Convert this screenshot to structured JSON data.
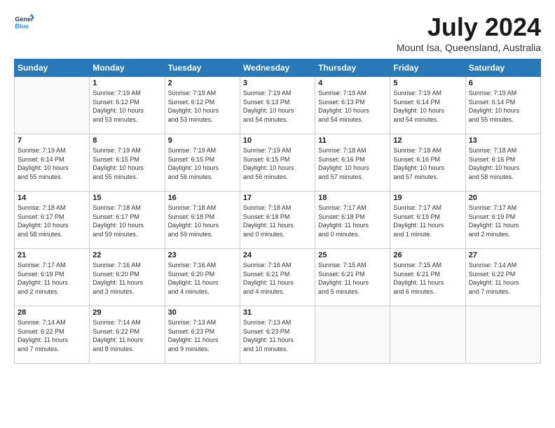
{
  "logo": {
    "line1": "General",
    "line2": "Blue"
  },
  "title": "July 2024",
  "location": "Mount Isa, Queensland, Australia",
  "headers": [
    "Sunday",
    "Monday",
    "Tuesday",
    "Wednesday",
    "Thursday",
    "Friday",
    "Saturday"
  ],
  "weeks": [
    [
      {
        "num": "",
        "info": ""
      },
      {
        "num": "1",
        "info": "Sunrise: 7:19 AM\nSunset: 6:12 PM\nDaylight: 10 hours\nand 53 minutes."
      },
      {
        "num": "2",
        "info": "Sunrise: 7:19 AM\nSunset: 6:12 PM\nDaylight: 10 hours\nand 53 minutes."
      },
      {
        "num": "3",
        "info": "Sunrise: 7:19 AM\nSunset: 6:13 PM\nDaylight: 10 hours\nand 54 minutes."
      },
      {
        "num": "4",
        "info": "Sunrise: 7:19 AM\nSunset: 6:13 PM\nDaylight: 10 hours\nand 54 minutes."
      },
      {
        "num": "5",
        "info": "Sunrise: 7:19 AM\nSunset: 6:14 PM\nDaylight: 10 hours\nand 54 minutes."
      },
      {
        "num": "6",
        "info": "Sunrise: 7:19 AM\nSunset: 6:14 PM\nDaylight: 10 hours\nand 55 minutes."
      }
    ],
    [
      {
        "num": "7",
        "info": "Sunrise: 7:19 AM\nSunset: 6:14 PM\nDaylight: 10 hours\nand 55 minutes."
      },
      {
        "num": "8",
        "info": "Sunrise: 7:19 AM\nSunset: 6:15 PM\nDaylight: 10 hours\nand 55 minutes."
      },
      {
        "num": "9",
        "info": "Sunrise: 7:19 AM\nSunset: 6:15 PM\nDaylight: 10 hours\nand 56 minutes."
      },
      {
        "num": "10",
        "info": "Sunrise: 7:19 AM\nSunset: 6:15 PM\nDaylight: 10 hours\nand 56 minutes."
      },
      {
        "num": "11",
        "info": "Sunrise: 7:18 AM\nSunset: 6:16 PM\nDaylight: 10 hours\nand 57 minutes."
      },
      {
        "num": "12",
        "info": "Sunrise: 7:18 AM\nSunset: 6:16 PM\nDaylight: 10 hours\nand 57 minutes."
      },
      {
        "num": "13",
        "info": "Sunrise: 7:18 AM\nSunset: 6:16 PM\nDaylight: 10 hours\nand 58 minutes."
      }
    ],
    [
      {
        "num": "14",
        "info": "Sunrise: 7:18 AM\nSunset: 6:17 PM\nDaylight: 10 hours\nand 58 minutes."
      },
      {
        "num": "15",
        "info": "Sunrise: 7:18 AM\nSunset: 6:17 PM\nDaylight: 10 hours\nand 59 minutes."
      },
      {
        "num": "16",
        "info": "Sunrise: 7:18 AM\nSunset: 6:18 PM\nDaylight: 10 hours\nand 59 minutes."
      },
      {
        "num": "17",
        "info": "Sunrise: 7:18 AM\nSunset: 6:18 PM\nDaylight: 11 hours\nand 0 minutes."
      },
      {
        "num": "18",
        "info": "Sunrise: 7:17 AM\nSunset: 6:18 PM\nDaylight: 11 hours\nand 0 minutes."
      },
      {
        "num": "19",
        "info": "Sunrise: 7:17 AM\nSunset: 6:19 PM\nDaylight: 11 hours\nand 1 minute."
      },
      {
        "num": "20",
        "info": "Sunrise: 7:17 AM\nSunset: 6:19 PM\nDaylight: 11 hours\nand 2 minutes."
      }
    ],
    [
      {
        "num": "21",
        "info": "Sunrise: 7:17 AM\nSunset: 6:19 PM\nDaylight: 11 hours\nand 2 minutes."
      },
      {
        "num": "22",
        "info": "Sunrise: 7:16 AM\nSunset: 6:20 PM\nDaylight: 11 hours\nand 3 minutes."
      },
      {
        "num": "23",
        "info": "Sunrise: 7:16 AM\nSunset: 6:20 PM\nDaylight: 11 hours\nand 4 minutes."
      },
      {
        "num": "24",
        "info": "Sunrise: 7:16 AM\nSunset: 6:21 PM\nDaylight: 11 hours\nand 4 minutes."
      },
      {
        "num": "25",
        "info": "Sunrise: 7:15 AM\nSunset: 6:21 PM\nDaylight: 11 hours\nand 5 minutes."
      },
      {
        "num": "26",
        "info": "Sunrise: 7:15 AM\nSunset: 6:21 PM\nDaylight: 11 hours\nand 6 minutes."
      },
      {
        "num": "27",
        "info": "Sunrise: 7:14 AM\nSunset: 6:22 PM\nDaylight: 11 hours\nand 7 minutes."
      }
    ],
    [
      {
        "num": "28",
        "info": "Sunrise: 7:14 AM\nSunset: 6:22 PM\nDaylight: 11 hours\nand 7 minutes."
      },
      {
        "num": "29",
        "info": "Sunrise: 7:14 AM\nSunset: 6:22 PM\nDaylight: 11 hours\nand 8 minutes."
      },
      {
        "num": "30",
        "info": "Sunrise: 7:13 AM\nSunset: 6:23 PM\nDaylight: 11 hours\nand 9 minutes."
      },
      {
        "num": "31",
        "info": "Sunrise: 7:13 AM\nSunset: 6:23 PM\nDaylight: 11 hours\nand 10 minutes."
      },
      {
        "num": "",
        "info": ""
      },
      {
        "num": "",
        "info": ""
      },
      {
        "num": "",
        "info": ""
      }
    ]
  ]
}
